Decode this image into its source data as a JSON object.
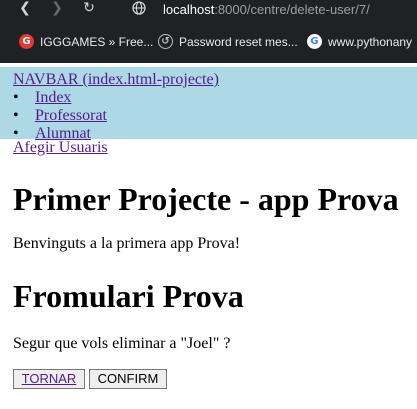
{
  "browser": {
    "url_host": "localhost",
    "url_path": ":8000/centre/delete-user/7/",
    "bookmarks": [
      {
        "label": "IGGGAMES » Free...",
        "icon": "igggames-icon",
        "color": "#e53935"
      },
      {
        "label": "Password reset mes...",
        "icon": "password-reset-icon",
        "color": "#9aa0a6"
      },
      {
        "label": "www.pythonany",
        "icon": "google-icon",
        "color": "#4285f4"
      }
    ]
  },
  "navbar": {
    "title": "NAVBAR (index.html-projecte)",
    "bullet": "•",
    "items": [
      {
        "label": "Index"
      },
      {
        "label": "Professorat"
      },
      {
        "label": "Alumnat"
      }
    ],
    "bg_color": "#add8e6"
  },
  "add_users_link": "Afegir Usuaris",
  "main": {
    "heading": "Primer Projecte - app Prova",
    "welcome": "Benvinguts a la primera app Prova!",
    "form_heading": "Fromulari Prova",
    "confirm_text": "Segur que vols eliminar a \"Joel\" ?",
    "back_button": "TORNAR",
    "confirm_button": "CONFIRM"
  }
}
